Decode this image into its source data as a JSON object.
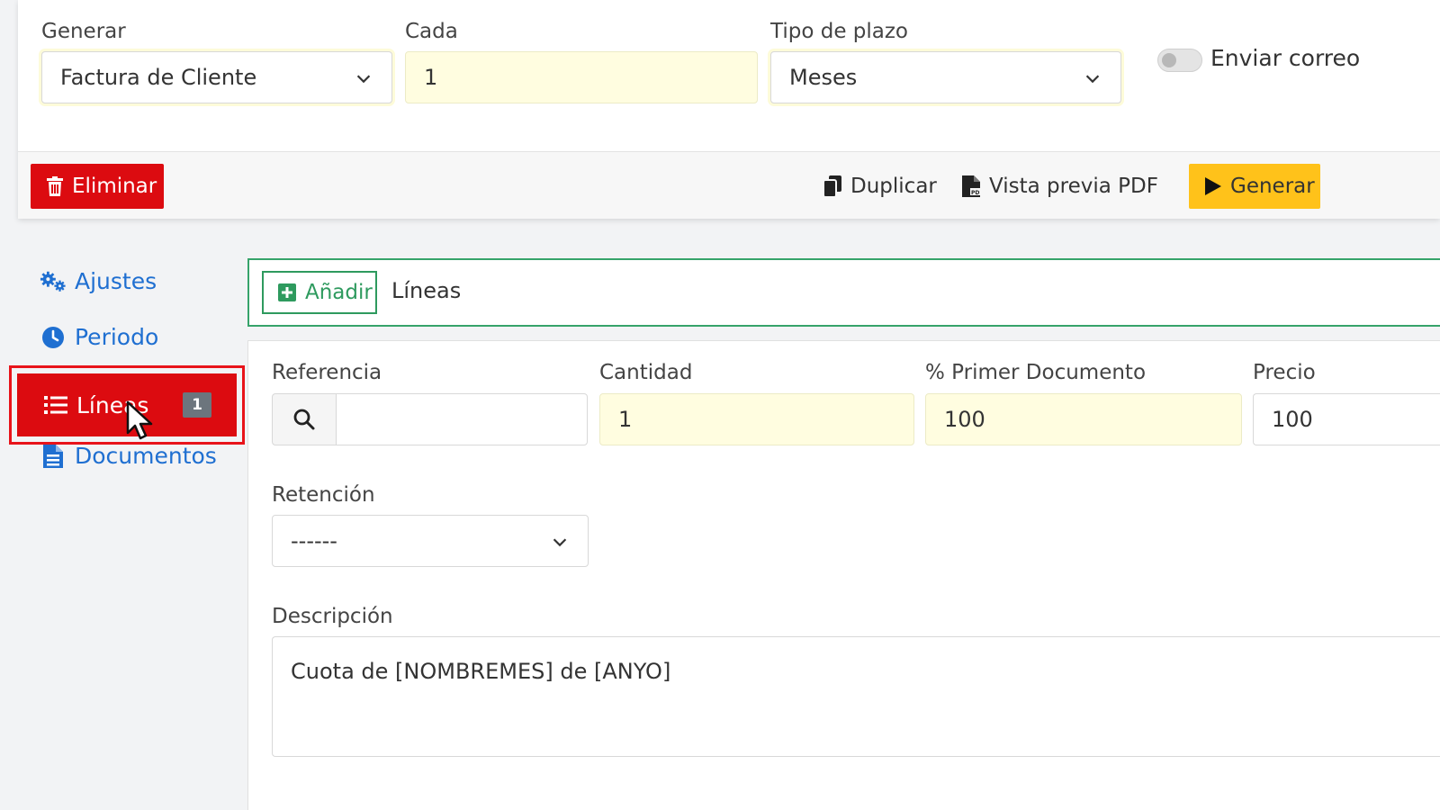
{
  "top_form": {
    "generar": {
      "label": "Generar",
      "value": "Factura de Cliente"
    },
    "cada": {
      "label": "Cada",
      "value": "1"
    },
    "tipo_plazo": {
      "label": "Tipo de plazo",
      "value": "Meses"
    },
    "enviar_correo": {
      "label": "Enviar correo",
      "checked": false
    }
  },
  "actions": {
    "eliminar": "Eliminar",
    "duplicar": "Duplicar",
    "vista_previa": "Vista previa PDF",
    "generar": "Generar"
  },
  "sidebar": {
    "items": [
      {
        "label": "Ajustes",
        "icon": "gears-icon"
      },
      {
        "label": "Periodo",
        "icon": "clock-icon"
      },
      {
        "label": "Líneas",
        "icon": "list-icon",
        "badge": "1",
        "active": true
      },
      {
        "label": "Documentos",
        "icon": "document-icon"
      }
    ]
  },
  "lines": {
    "add_label": "Añadir",
    "title": "Líneas",
    "referencia": {
      "label": "Referencia",
      "value": ""
    },
    "cantidad": {
      "label": "Cantidad",
      "value": "1"
    },
    "primer_documento": {
      "label": "% Primer Documento",
      "value": "100"
    },
    "precio": {
      "label": "Precio",
      "value": "100"
    },
    "retencion": {
      "label": "Retención",
      "value": "------"
    },
    "descripcion": {
      "label": "Descripción",
      "value": "Cuota de [NOMBREMES] de [ANYO]"
    }
  },
  "colors": {
    "danger": "#dc0b10",
    "warning": "#ffc21a",
    "link": "#1f6fd1",
    "success": "#2e9a5e",
    "highlight_field": "#fffde0"
  }
}
